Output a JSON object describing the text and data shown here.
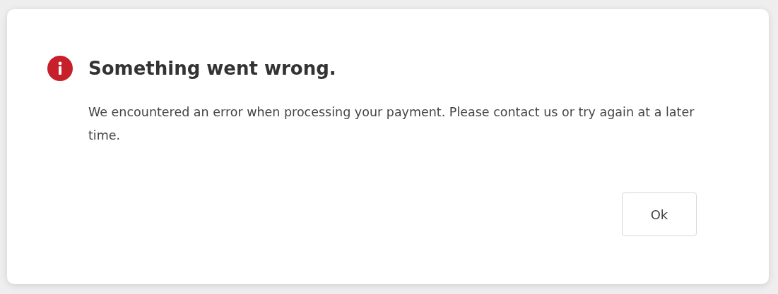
{
  "dialog": {
    "title": "Something went wrong.",
    "message": "We encountered an error when processing your payment. Please contact us or try again at a later time.",
    "buttons": [
      "Ok"
    ]
  }
}
